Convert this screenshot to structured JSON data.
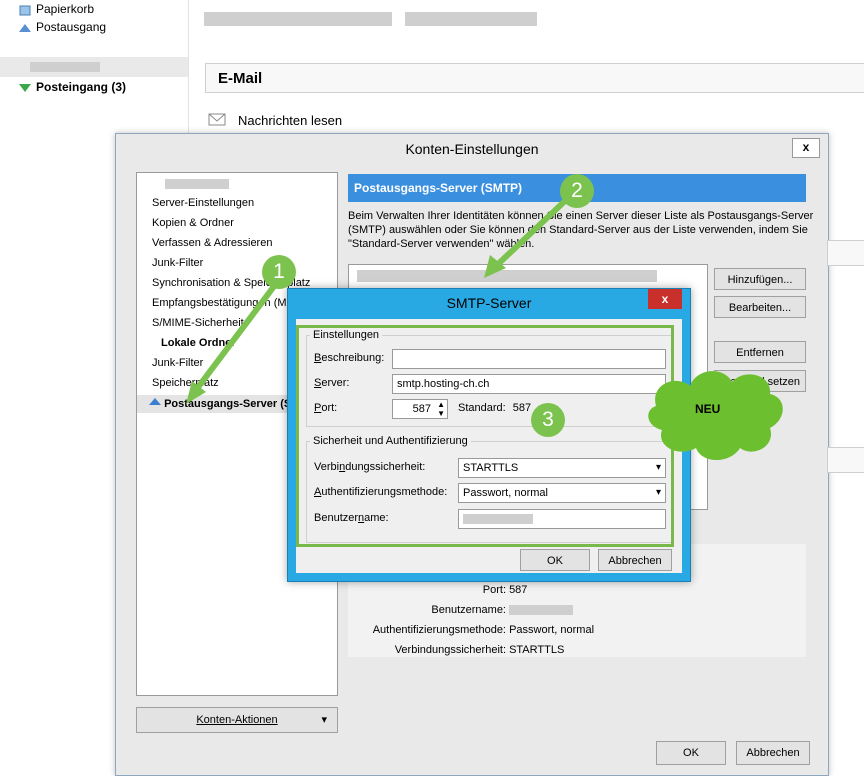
{
  "background": {
    "tree": [
      {
        "label": "Papierkorb",
        "icon": "trash-icon"
      },
      {
        "label": "Postausgang",
        "icon": "outbox-icon"
      },
      {
        "label": "Posteingang (3)",
        "icon": "inbox-icon"
      }
    ],
    "email_header": "E-Mail",
    "read_messages": "Nachrichten lesen"
  },
  "account_dialog": {
    "title": "Konten-Einstellungen",
    "close": "x",
    "tree": [
      "Server-Einstellungen",
      "Kopien & Ordner",
      "Verfassen & Adressieren",
      "Junk-Filter",
      "Synchronisation & Speicherplatz",
      "Empfangsbestätigungen (MDN)",
      "S/MIME-Sicherheit",
      "Lokale Ordner",
      "Junk-Filter",
      "Speicherplatz",
      "Postausgangs-Server (SMTP)"
    ],
    "panel_title": "Postausgangs-Server (SMTP)",
    "panel_desc": "Beim Verwalten Ihrer Identitäten können Sie einen Server dieser Liste als Postausgangs-Server (SMTP) auswählen oder Sie können den Standard-Server aus der Liste verwenden, indem Sie \"Standard-Server verwenden\" wählen.",
    "buttons": {
      "add": "Hinzufügen...",
      "edit": "Bearbeiten...",
      "remove": "Entfernen",
      "set_default": "Standard setzen",
      "account_actions": "Konten-Aktionen",
      "ok": "OK",
      "cancel": "Abbrechen"
    },
    "details": [
      {
        "key": "Port:",
        "value": "587"
      },
      {
        "key": "Benutzername:",
        "value": ""
      },
      {
        "key": "Authentifizierungsmethode:",
        "value": "Passwort, normal"
      },
      {
        "key": "Verbindungssicherheit:",
        "value": "STARTTLS"
      }
    ]
  },
  "smtp_dialog": {
    "title": "SMTP-Server",
    "close": "x",
    "settings_group": "Einstellungen",
    "description_label": "Beschreibung:",
    "description_value": "",
    "server_label": "Server:",
    "server_value": "smtp.hosting-ch.ch",
    "port_label": "Port:",
    "port_value": "587",
    "default_label": "Standard:",
    "default_value": "587",
    "security_group": "Sicherheit und Authentifizierung",
    "conn_security_label": "Verbindungssicherheit:",
    "conn_security_value": "STARTTLS",
    "auth_label": "Authentifizierungsmethode:",
    "auth_value": "Passwort, normal",
    "username_label": "Benutzername:",
    "username_value": "",
    "ok": "OK",
    "cancel": "Abbrechen"
  },
  "annotations": {
    "step1": "1",
    "step2": "2",
    "step3": "3",
    "new_label": "NEU",
    "accent_color": "#7cc24e"
  }
}
